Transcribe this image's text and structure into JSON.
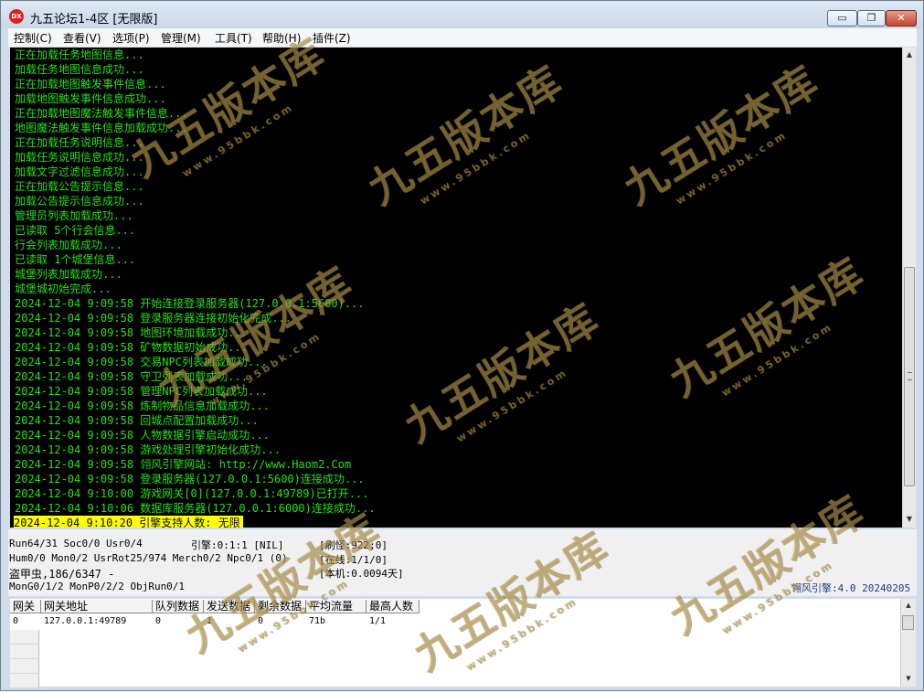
{
  "window": {
    "title": "九五论坛1-4区 [无限版]",
    "app_icon": "DX",
    "minimize_label": "▭",
    "maximize_label": "❐",
    "close_label": "✕"
  },
  "menu": [
    {
      "label": "控制(C)"
    },
    {
      "label": "查看(V)"
    },
    {
      "label": "选项(P)"
    },
    {
      "label": "管理(M)"
    },
    {
      "label": "工具(T)"
    },
    {
      "label": "帮助(H)"
    },
    {
      "label": "插件(Z)"
    }
  ],
  "console": {
    "lines": [
      "正在加载任务地图信息...",
      "加载任务地图信息成功...",
      "正在加载地图触发事件信息...",
      "加载地图触发事件信息成功...",
      "正在加载地图魔法触发事件信息...",
      "地图魔法触发事件信息加载成功...",
      "正在加载任务说明信息...",
      "加载任务说明信息成功...",
      "加载文字过滤信息成功...",
      "正在加载公告提示信息...",
      "加载公告提示信息成功...",
      "管理员列表加载成功...",
      "已读取 5个行会信息...",
      "行会列表加载成功...",
      "已读取 1个城堡信息...",
      "城堡列表加载成功...",
      "城堡城初始完成...",
      "2024-12-04 9:09:58 开始连接登录服务器(127.0.0.1:5600)...",
      "2024-12-04 9:09:58 登录服务器连接初始化完成...",
      "2024-12-04 9:09:58 地图环境加载成功...",
      "2024-12-04 9:09:58 矿物数据初始成功...",
      "2024-12-04 9:09:58 交易NPC列表加载成功...",
      "2024-12-04 9:09:58 守卫列表加载成功...",
      "2024-12-04 9:09:58 管理NPC列表加载成功...",
      "2024-12-04 9:09:58 炼制物品信息加载成功...",
      "2024-12-04 9:09:58 回城点配置加载成功...",
      "2024-12-04 9:09:58 人物数据引擎启动成功...",
      "2024-12-04 9:09:58 游戏处理引擎初始化成功...",
      "2024-12-04 9:09:58 翎风引擎网站: http://www.Haom2.Com",
      "2024-12-04 9:09:58 登录服务器(127.0.0.1:5600)连接成功...",
      "2024-12-04 9:10:00 游戏网关[0](127.0.0.1:49789)已打开...",
      "2024-12-04 9:10:06 数据库服务器(127.0.0.1:6000)连接成功..."
    ],
    "highlight_line": "2024-12-04 9:10:20 引擎支持人数: 无限"
  },
  "status": {
    "run": "Run64/31 Soc0/0 Usr0/4",
    "engine": "引擎:0:1:1 [NIL]",
    "refresh": "[刷怪:922;0]",
    "hum": "Hum0/0 Mon0/2 UsrRot25/974 Merch0/2 Npc0/1 (0)",
    "online": "[在线:1/1/0]",
    "thief": "盗甲虫,186/6347 -",
    "local": "[本机:0.0094天]",
    "mon": "MonG0/1/2 MonP0/2/2 ObjRun0/1",
    "version": "翎风引擎:4.0 20240205"
  },
  "gateway_table": {
    "headers": [
      "网关",
      "网关地址",
      "队列数据",
      "发送数据",
      "剩余数据",
      "平均流量",
      "最高人数"
    ],
    "rows": [
      [
        "0",
        "127.0.0.1:49789",
        "0",
        "1",
        "0",
        "71b",
        "1/1"
      ]
    ]
  },
  "watermark": {
    "text": "九五版本库",
    "url": "www.95bbk.com"
  }
}
